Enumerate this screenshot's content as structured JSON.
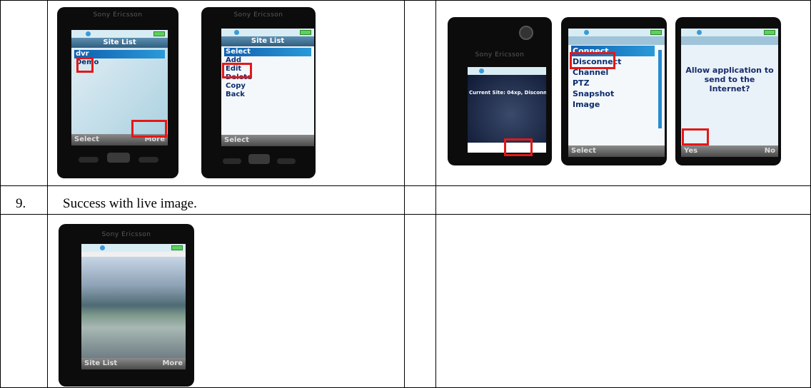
{
  "row_step": {
    "number": "9.",
    "text": "Success with live image."
  },
  "phones": {
    "brand": "Sony Ericsson",
    "site_list": {
      "title": "Site List",
      "items": [
        "dvr",
        "Demo"
      ],
      "soft_left": "Select",
      "soft_right": "More"
    },
    "site_menu": {
      "title": "Site List",
      "items": [
        "Select",
        "Add",
        "Edit",
        "Delete",
        "Copy",
        "Back"
      ],
      "soft_left": "Select"
    },
    "viewer": {
      "status": "Current Site: 04xp, Disconn"
    },
    "connect_menu": {
      "items": [
        "Connect",
        "Disconnect",
        "Channel",
        "PTZ",
        "Snapshot",
        "Image"
      ],
      "soft_left": "Select"
    },
    "dialog": {
      "text": "Allow application to send to the Internet?",
      "soft_left": "Yes",
      "soft_right": "No"
    },
    "live": {
      "soft_left": "Site List",
      "soft_right": "More"
    }
  }
}
